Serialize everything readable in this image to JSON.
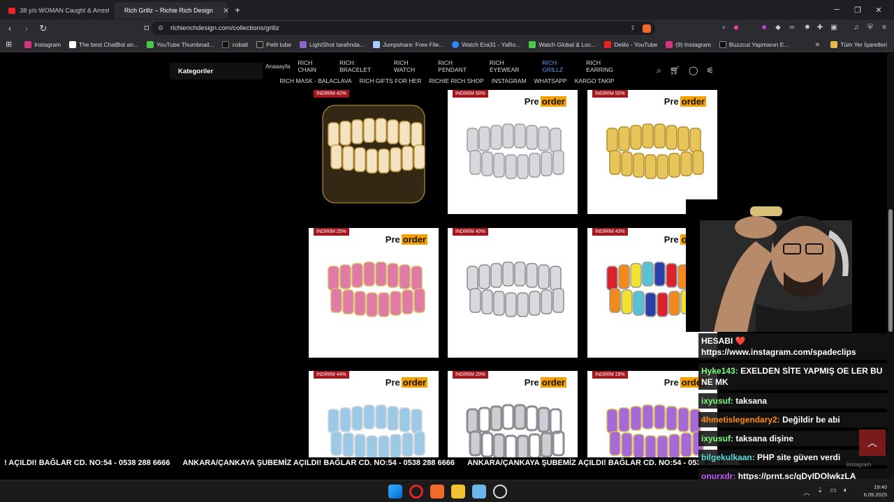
{
  "tabs": [
    {
      "label": "38 y/o WOMAN Caught & Arrested ...",
      "active": false
    },
    {
      "label": "Rich Grillz – Richie Rich Design",
      "active": true
    }
  ],
  "address": {
    "url": "richierichdesign.com/collections/grillz"
  },
  "bookmarks": [
    "Instagram",
    "The best ChatBot an...",
    "YouTube Thumbnail...",
    "cobalt",
    "Petit tube",
    "LightShot tarafında...",
    "Jumpshare: Free File...",
    "Watch Era31 - YaRo...",
    "Watch Global & Loc...",
    "Delilo - YouTube",
    "(9) Instagram",
    "Buzzcut Yapmanın E..."
  ],
  "bookmarks_folder": "Tüm Yer İşaretleri",
  "site": {
    "categories_label": "Kategoriler",
    "menu_row1": [
      "Anasayfa",
      "RICH CHAIN",
      "RICH BRACELET",
      "RICH WATCH",
      "RICH PENDANT",
      "RICH EYEWEAR",
      "RICH GRILLZ",
      "RICH EARRING"
    ],
    "menu_row2": [
      "RICH MASK - BALACLAVA",
      "RICH GIFTS FOR HER",
      "RICHIE RICH SHOP",
      "INSTAGRAM",
      "WHATSAPP",
      "KARGO TAKİP"
    ],
    "active_menu": "RICH GRILLZ",
    "preorder_pre": "Pre",
    "preorder_order": "order",
    "products": [
      {
        "badge": "İNDİRİM 42%",
        "preorder": false,
        "style": "denture"
      },
      {
        "badge": "İNDİRİM 50%",
        "preorder": true,
        "style": "silver-iced"
      },
      {
        "badge": "İNDİRİM 50%",
        "preorder": true,
        "style": "gold-plain"
      },
      {
        "badge": "İNDİRİM 25%",
        "preorder": true,
        "style": "pink-iced"
      },
      {
        "badge": "İNDİRİM 40%",
        "preorder": false,
        "style": "silver-plain"
      },
      {
        "badge": "İNDİRİM 43%",
        "preorder": true,
        "style": "rainbow"
      },
      {
        "badge": "İNDİRİM 44%",
        "preorder": true,
        "style": "blue-iced"
      },
      {
        "badge": "İNDİRİM 20%",
        "preorder": true,
        "style": "silver-open"
      },
      {
        "badge": "İNDİRİM 29%",
        "preorder": true,
        "style": "purple-iced"
      }
    ],
    "ticker": [
      "! AÇILDI! BAĞLAR CD. NO:54 - 0538 288 6666",
      "ANKARA/ÇANKAYA ŞUBEMİZ AÇILDI! BAĞLAR CD. NO:54 - 0538 288 6666",
      "ANKARA/ÇANKAYA ŞUBEMİZ AÇILDI! BAĞLAR CD. NO:54 - 0538 288 6666"
    ]
  },
  "chat": [
    {
      "user": "",
      "text": "HESABI ❤️ https://www.instagram.com/spadeclips",
      "color": "#ffffff"
    },
    {
      "user": "Hyke143:",
      "text": "EXELDEN SİTE YAPMIŞ OE LER BU NE MK",
      "color": "#7cfc7c"
    },
    {
      "user": "ixyusuf:",
      "text": "taksana",
      "color": "#7cfc7c"
    },
    {
      "user": "4hmetislegendary2:",
      "text": "Değildir be abi",
      "color": "#ff8c1a"
    },
    {
      "user": "ixyusuf:",
      "text": "taksana dişine",
      "color": "#7cfc7c"
    },
    {
      "user": "bilgekulkaan:",
      "text": "PHP site güven verdi",
      "color": "#55dddd"
    },
    {
      "user": "onurxdr:",
      "text": "https://prnt.sc/gDyIDOlwkzLA",
      "color": "#c65bff"
    }
  ],
  "overlay_tag": "instagram",
  "clock": {
    "time": "19:40",
    "date": "6.09.2025"
  }
}
